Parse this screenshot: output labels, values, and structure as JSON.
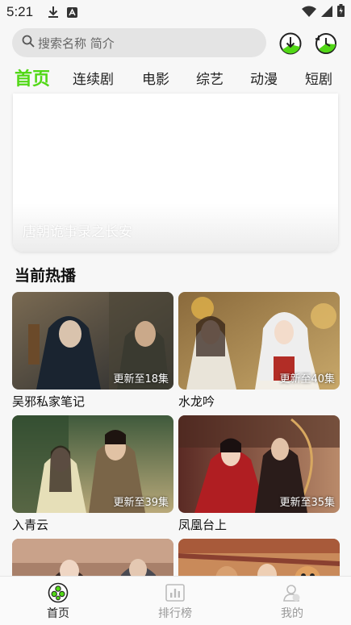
{
  "status_bar": {
    "time": "5:21"
  },
  "search": {
    "placeholder": "搜索名称 简介"
  },
  "tabs": [
    {
      "label": "首页",
      "active": true
    },
    {
      "label": "连续剧",
      "active": false
    },
    {
      "label": "电影",
      "active": false
    },
    {
      "label": "综艺",
      "active": false
    },
    {
      "label": "动漫",
      "active": false
    },
    {
      "label": "短剧",
      "active": false
    }
  ],
  "banner": {
    "title": "唐朝诡事录之长安"
  },
  "section": {
    "title": "当前热播"
  },
  "cards": [
    {
      "title": "吴邪私家笔记",
      "badge": "更新至18集"
    },
    {
      "title": "水龙吟",
      "badge": "更新至40集"
    },
    {
      "title": "入青云",
      "badge": "更新至39集"
    },
    {
      "title": "凤凰台上",
      "badge": "更新至35集"
    }
  ],
  "bottom_nav": [
    {
      "label": "首页",
      "active": true
    },
    {
      "label": "排行榜",
      "active": false
    },
    {
      "label": "我的",
      "active": false
    }
  ],
  "colors": {
    "accent": "#52d817",
    "text": "#222222",
    "muted": "#999999"
  }
}
